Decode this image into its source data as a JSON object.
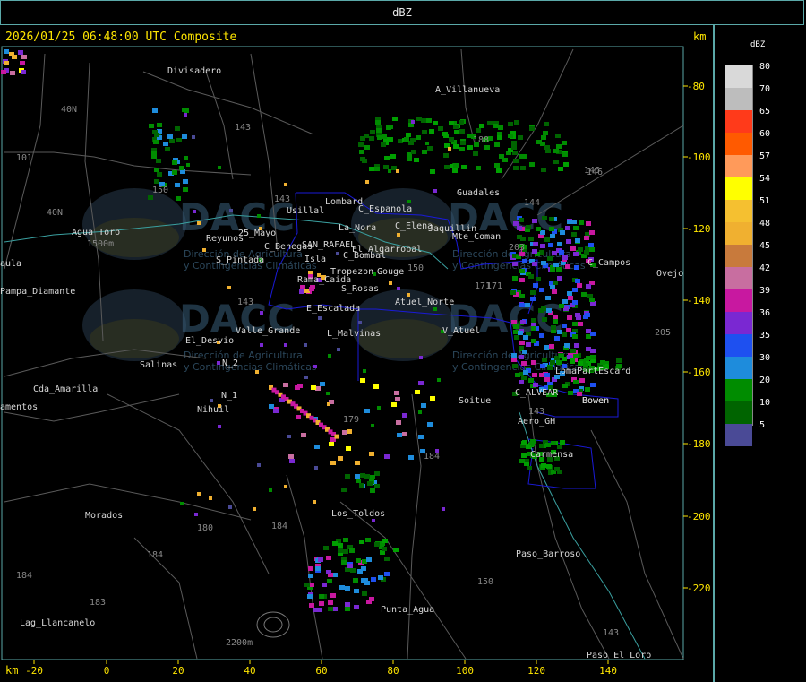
{
  "window": {
    "title": "dBZ"
  },
  "map": {
    "title": "2026/01/25 06:48:00 UTC Composite",
    "km_label_top": "km",
    "km_label_bottom": "km",
    "x_ticks": [
      "-20",
      "0",
      "20",
      "40",
      "60",
      "80",
      "100",
      "120",
      "140"
    ],
    "y_ticks": [
      "-80",
      "-100",
      "-120",
      "-140",
      "-160",
      "-180",
      "-200",
      "-220"
    ],
    "places": [
      "Divisadero",
      "A_Villanueva",
      "Guadales",
      "Usillal",
      "Lombard",
      "C_Espanola",
      "C_Elena",
      "Jaquillin",
      "Mte_Coman",
      "La_Nora",
      "Reyunos",
      "25_Mayo",
      "C_Benegas",
      "SAN_RAFAEL",
      "El_Algarrobal",
      "C_Bombal",
      "Isla",
      "Tropezon",
      "Gouge",
      "S_Pintada",
      "Rama_Caida",
      "S_Rosas",
      "Atuel_Norte",
      "E_Escalada",
      "Valle_Grande",
      "L_Malvinas",
      "V_Atuel",
      "El_Desvio",
      "Salinas",
      "N_2",
      "N_1",
      "Nihuil",
      "Soitue",
      "Agua_Toro",
      "Pampa_Diamante",
      "Cda_Amarilla",
      "amentos",
      "aula",
      "Morados",
      "Los_Toldos",
      "Paso_Barroso",
      "Punta_Agua",
      "Lag_Llancanelo",
      "Paso_El_Loro",
      "Aero_GH",
      "Bowen",
      "C_ALVEAR",
      "LomaPartEscard",
      "Carmensa",
      "Ovejo",
      "C_Campos",
      "Bowen"
    ],
    "roads": [
      "40N",
      "101",
      "40N",
      "143",
      "143",
      "150",
      "143",
      "171",
      "203",
      "146",
      "144",
      "146",
      "179",
      "188",
      "184",
      "184",
      "180",
      "184",
      "183",
      "184",
      "150",
      "143",
      "2200m",
      "1500m",
      "205",
      "171",
      "143",
      "150"
    ],
    "watermark": {
      "logo_text": "DACC",
      "subtitle_1": "Dirección de Agricultura",
      "subtitle_2": "y Contingencias Climáticas"
    }
  },
  "legend": {
    "title": "dBZ",
    "entries": [
      {
        "value": "80",
        "color": "#d9d9d9"
      },
      {
        "value": "70",
        "color": "#bdbdbd"
      },
      {
        "value": "65",
        "color": "#ff3a1a"
      },
      {
        "value": "60",
        "color": "#ff5a00"
      },
      {
        "value": "57",
        "color": "#ff9a5a"
      },
      {
        "value": "54",
        "color": "#ffff00"
      },
      {
        "value": "51",
        "color": "#f5c030"
      },
      {
        "value": "48",
        "color": "#f0b030"
      },
      {
        "value": "45",
        "color": "#c87a3c"
      },
      {
        "value": "42",
        "color": "#c86ea0"
      },
      {
        "value": "39",
        "color": "#c818a0"
      },
      {
        "value": "36",
        "color": "#7a28d2"
      },
      {
        "value": "35",
        "color": "#1e50f0"
      },
      {
        "value": "30",
        "color": "#1e8cdc"
      },
      {
        "value": "20",
        "color": "#008c00"
      },
      {
        "value": "10",
        "color": "#006400"
      },
      {
        "value": "5",
        "color": "#4a4a96"
      }
    ]
  }
}
